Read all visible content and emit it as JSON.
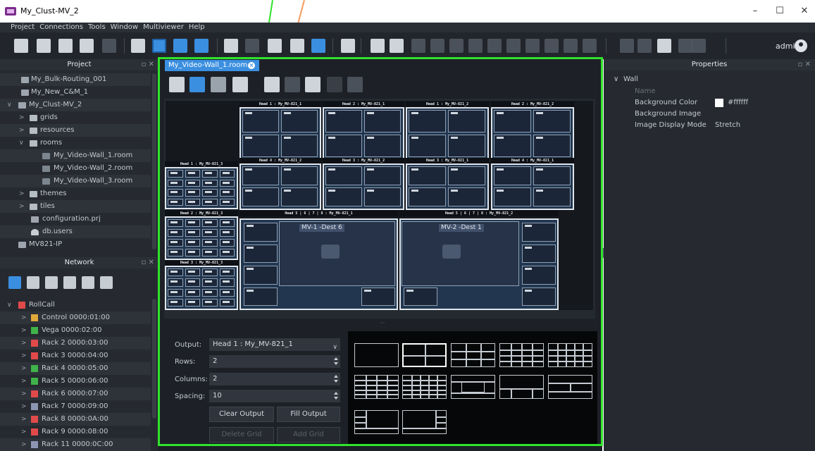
{
  "window": {
    "title": "My_Clust-MV_2",
    "minimize": "–",
    "maximize": "☐",
    "close": "✕"
  },
  "menu": [
    "Project",
    "Connections",
    "Tools",
    "Window",
    "Multiviewer",
    "Help"
  ],
  "user": {
    "name": "admin"
  },
  "project_panel": {
    "title": "Project",
    "items": [
      {
        "label": "My_Bulk-Routing_001"
      },
      {
        "label": "My_New_C&M_1"
      },
      {
        "label": "My_Clust-MV_2"
      },
      {
        "label": "grids"
      },
      {
        "label": "resources"
      },
      {
        "label": "rooms"
      },
      {
        "label": "My_Video-Wall_1.room"
      },
      {
        "label": "My_Video-Wall_2.room"
      },
      {
        "label": "My_Video-Wall_3.room"
      },
      {
        "label": "themes"
      },
      {
        "label": "tiles"
      },
      {
        "label": "configuration.prj"
      },
      {
        "label": "db.users"
      },
      {
        "label": "MV821-IP"
      }
    ]
  },
  "network_panel": {
    "title": "Network",
    "items": [
      {
        "label": "RollCall"
      },
      {
        "label": "Control 0000:01:00"
      },
      {
        "label": "Vega 0000:02:00"
      },
      {
        "label": "Rack 2 0000:03:00"
      },
      {
        "label": "Rack 3 0000:04:00"
      },
      {
        "label": "Rack 4 0000:05:00"
      },
      {
        "label": "Rack 5 0000:06:00"
      },
      {
        "label": "Rack 6 0000:07:00"
      },
      {
        "label": "Rack 7 0000:09:00"
      },
      {
        "label": "Rack 8 0000:0A:00"
      },
      {
        "label": "Rack 9 0000:08:00"
      },
      {
        "label": "Rack 11 0000:0C:00"
      }
    ]
  },
  "editor": {
    "tab": "My_Video-Wall_1.room",
    "heads": {
      "h1a": "Head 1 : My_MV-821_1",
      "h2a": "Head 2 : My_MV-821_1",
      "h1b": "Head 1 : My_MV-821_2",
      "h2b": "Head 2 : My_MV-821_2",
      "h1c": "Head 1 : My_MV-821_3",
      "h4a": "Head 4 : My_MV-821_2",
      "h3a": "Head 3 : My_MV-821_2",
      "h3b": "Head 3 : My_MV-821_1",
      "h4b": "Head 4 : My_MV-821_1",
      "h2c": "Head 2 : My_MV-821_3",
      "h5a": "Head 5 | 6 | 7 | 8 : My_MV-821_1",
      "h5b": "Head 5 | 6 | 7 | 8 : My_MV-821_2",
      "h3c": "Head 3 : My_MV-821_3"
    },
    "mv1": "MV-1 -Dest 6",
    "mv2": "MV-2 -Dest 1"
  },
  "grid_form": {
    "output_label": "Output:",
    "output_value": "Head 1 : My_MV-821_1",
    "rows_label": "Rows:",
    "rows_value": "2",
    "columns_label": "Columns:",
    "columns_value": "2",
    "spacing_label": "Spacing:",
    "spacing_value": "10",
    "clear_output": "Clear Output",
    "fill_output": "Fill Output",
    "delete_grid": "Delete Grid",
    "add_grid": "Add Grid"
  },
  "properties": {
    "title": "Properties",
    "section": "Wall",
    "name_label": "Name",
    "bg_color_label": "Background Color",
    "bg_color_value": "#ffffff",
    "bg_image_label": "Background Image",
    "display_mode_label": "Image Display Mode",
    "display_mode_value": "Stretch"
  },
  "colors": {
    "accent": "#3b8fe0",
    "highlight_frame": "#2fe32b",
    "annotation_orange": "#f39a5a"
  }
}
